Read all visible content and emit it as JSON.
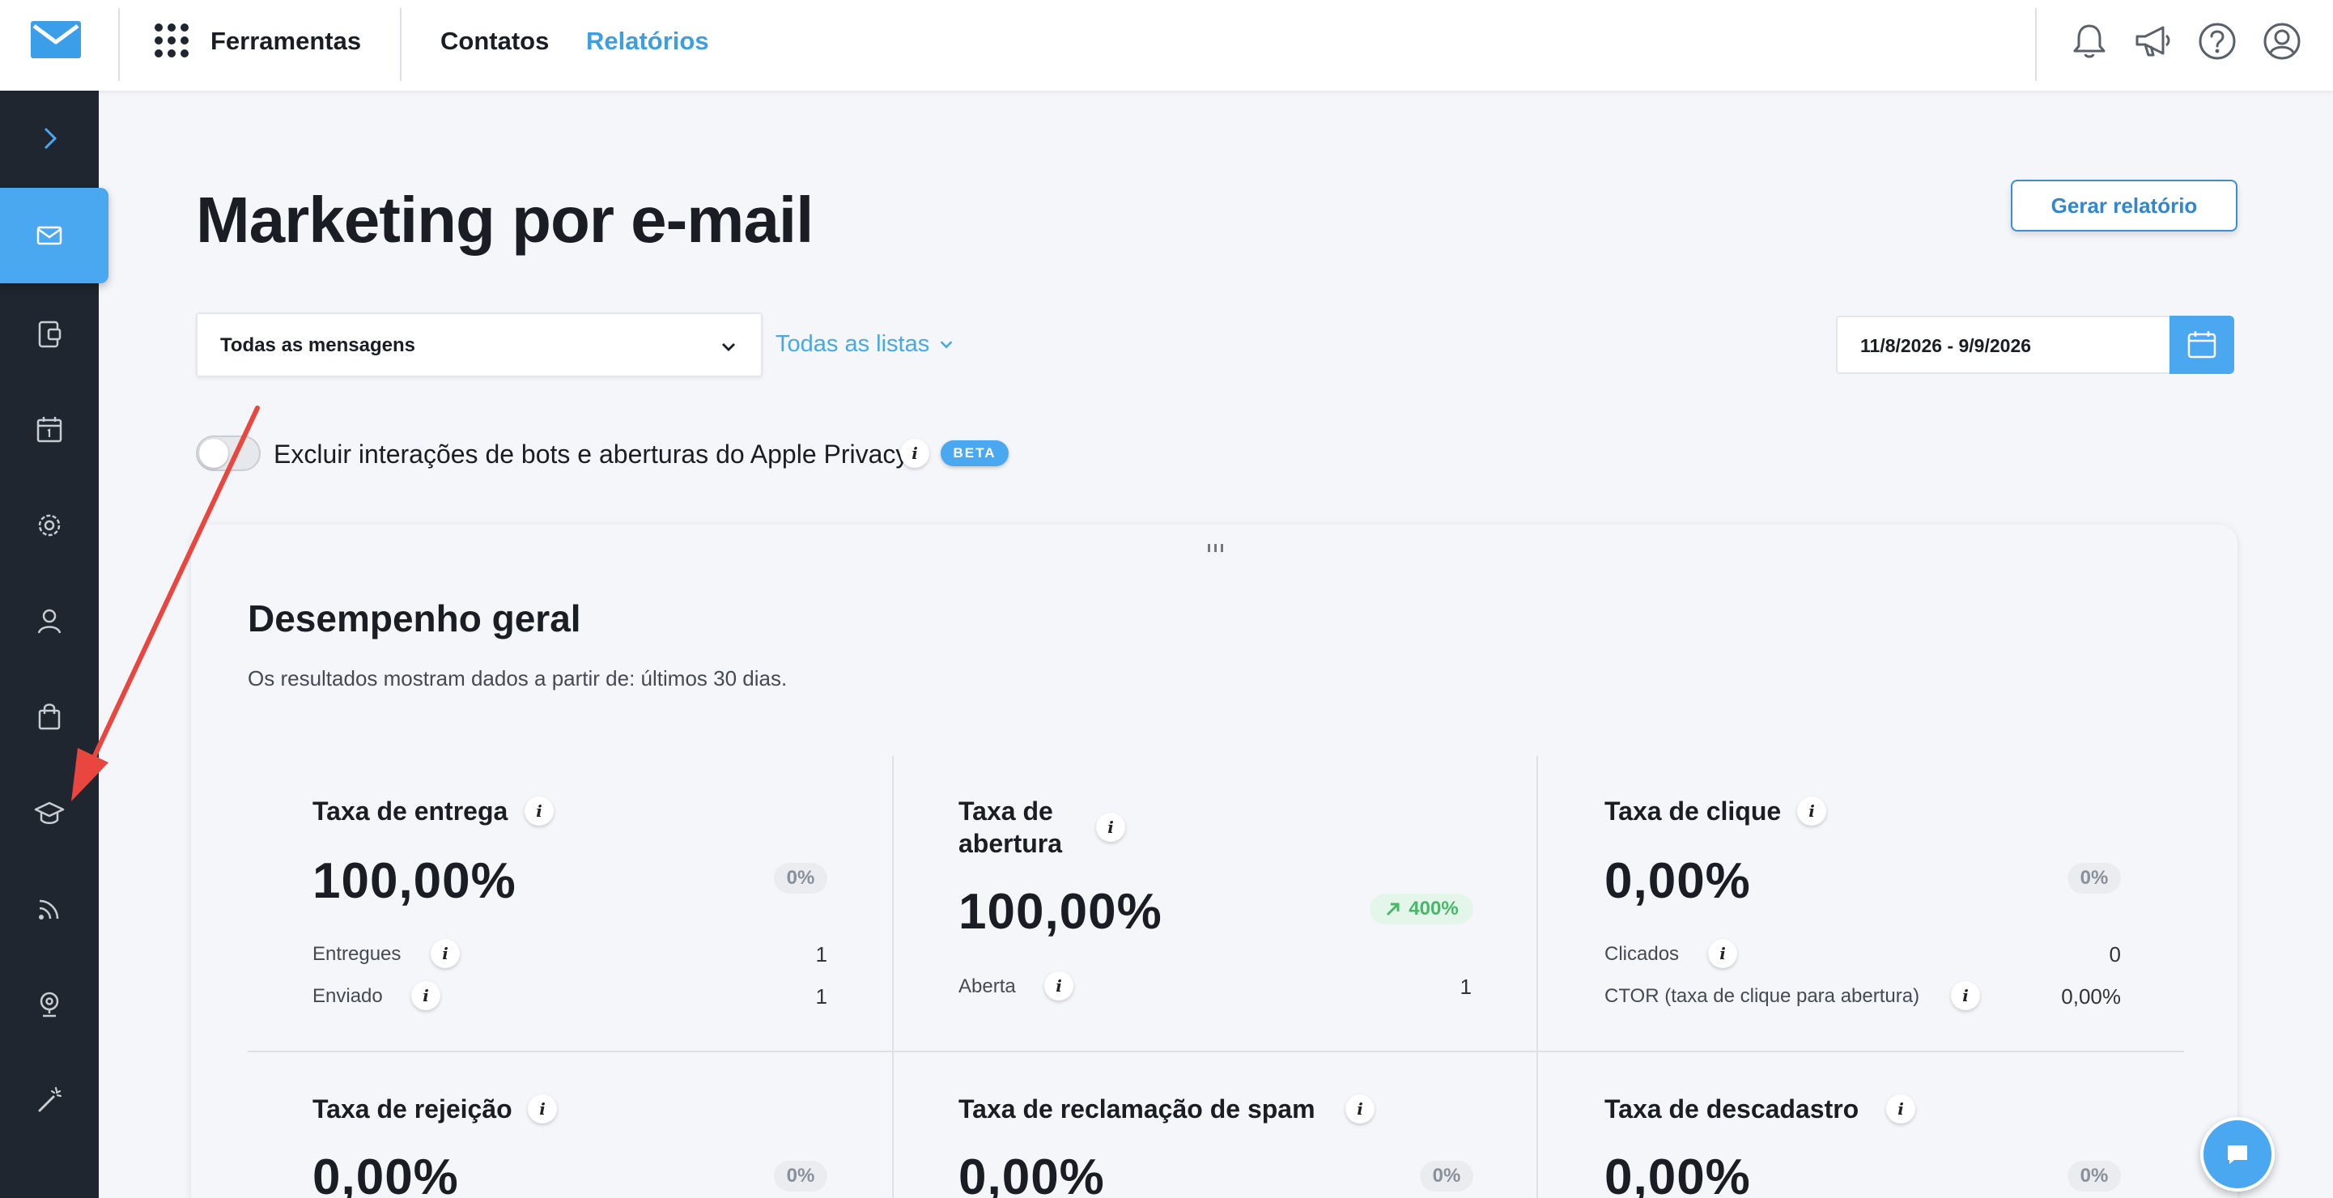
{
  "topbar": {
    "tools_label": "Ferramentas",
    "nav": [
      {
        "label": "Contatos",
        "active": false
      },
      {
        "label": "Relatórios",
        "active": true
      }
    ],
    "icons": [
      "bell-icon",
      "megaphone-icon",
      "help-icon",
      "user-profile-icon"
    ]
  },
  "sidebar": {
    "items": [
      "expand-chevron-icon",
      "email-icon",
      "landing-page-icon",
      "calendar-icon",
      "automation-gear-icon",
      "contacts-person-icon",
      "shopping-bag-icon",
      "education-cap-icon",
      "rss-feed-icon",
      "webinar-icon",
      "magic-wand-icon"
    ],
    "active": "email-icon"
  },
  "page": {
    "title": "Marketing por e-mail",
    "generate_report": "Gerar relatório"
  },
  "filters": {
    "messages_select": "Todas as mensagens",
    "lists_dropdown": "Todas as listas",
    "date_range": "11/8/2026 - 9/9/2026",
    "toggle_label": "Excluir interações de bots e aberturas do Apple Privacy",
    "toggle_on": false,
    "beta_badge": "BETA",
    "info_glyph": "i"
  },
  "overview": {
    "title": "Desempenho geral",
    "subtitle": "Os resultados mostram dados a partir de: últimos 30 dias.",
    "metrics": [
      {
        "title": "Taxa de entrega",
        "value": "100,00%",
        "change": "0%",
        "rows": [
          {
            "label": "Entregues",
            "value": "1"
          },
          {
            "label": "Enviado",
            "value": "1"
          }
        ]
      },
      {
        "title_line1": "Taxa de",
        "title_line2": "abertura",
        "value": "100,00%",
        "change": "400%",
        "change_trend": "up",
        "rows": [
          {
            "label": "Aberta",
            "value": "1"
          }
        ]
      },
      {
        "title": "Taxa de clique",
        "value": "0,00%",
        "change": "0%",
        "rows": [
          {
            "label": "Clicados",
            "value": "0"
          },
          {
            "label": "CTOR (taxa de clique para abertura)",
            "value": "0,00%"
          }
        ]
      },
      {
        "title": "Taxa de rejeição",
        "value": "0,00%",
        "change": "0%"
      },
      {
        "title": "Taxa de reclamação de spam",
        "value": "0,00%",
        "change": "0%"
      },
      {
        "title": "Taxa de descadastro",
        "value": "0,00%",
        "change": "0%"
      }
    ]
  },
  "colors": {
    "accent": "#4aa8f0",
    "sidebar": "#1f262f",
    "positive": "#47b86a",
    "annotation_arrow": "#e8463f"
  }
}
